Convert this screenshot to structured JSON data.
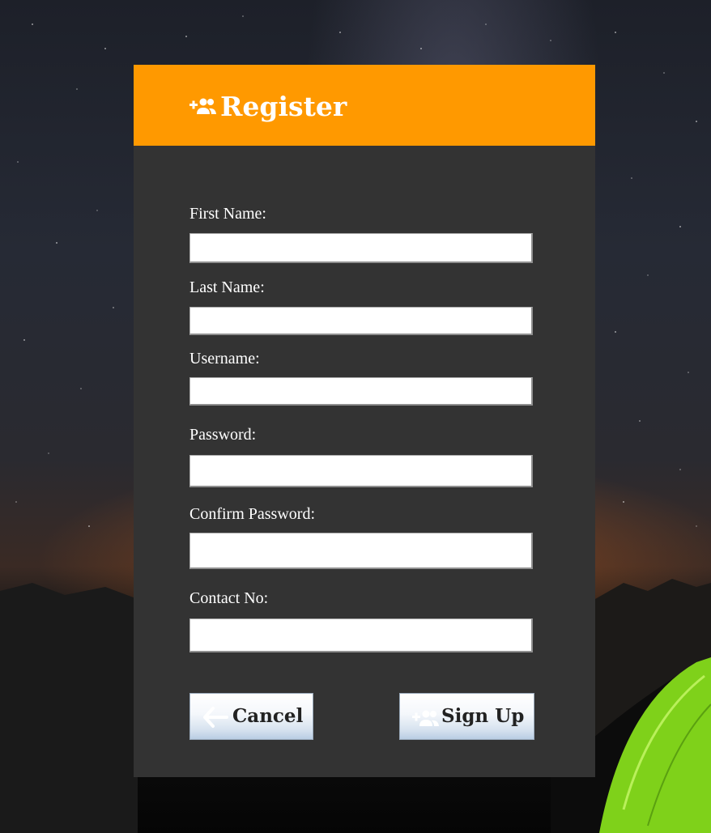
{
  "header": {
    "title": "Register",
    "icon": "add-user-icon"
  },
  "form": {
    "fields": [
      {
        "label": "First Name:",
        "value": "",
        "placeholder": ""
      },
      {
        "label": "Last Name:",
        "value": "",
        "placeholder": ""
      },
      {
        "label": "Username:",
        "value": "",
        "placeholder": ""
      },
      {
        "label": "Password:",
        "value": "",
        "placeholder": ""
      },
      {
        "label": "Confirm Password:",
        "value": "",
        "placeholder": ""
      },
      {
        "label": "Contact No:",
        "value": "",
        "placeholder": ""
      }
    ]
  },
  "buttons": {
    "cancel_label": "Cancel",
    "cancel_icon": "arrow-left-icon",
    "signup_label": "Sign Up",
    "signup_icon": "add-user-icon"
  },
  "colors": {
    "header": "#ff9900",
    "panel": "#333333",
    "text_light": "#ffffff"
  }
}
